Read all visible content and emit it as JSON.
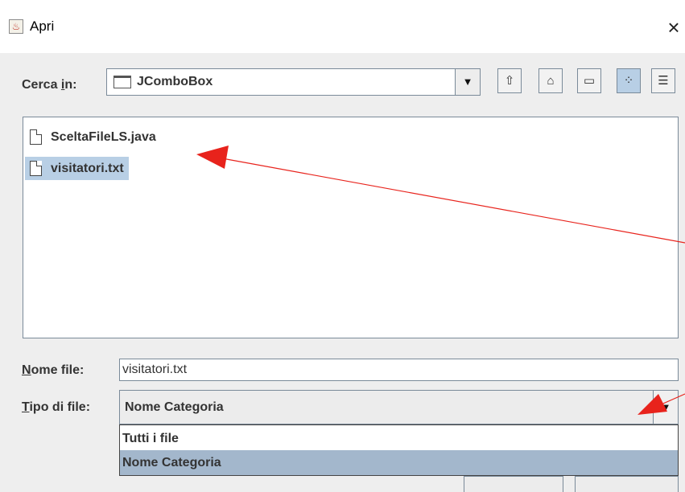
{
  "window": {
    "title": "Apri",
    "close_glyph": "×",
    "app_icon": "java-cup-icon"
  },
  "look_in": {
    "label_prefix": "Cerca ",
    "label_mnemonic": "i",
    "label_suffix": "n:",
    "value": "JComboBox",
    "folder_icon": "folder-icon",
    "arrow": "▼"
  },
  "toolbar": {
    "up_glyph": "⇧",
    "home_glyph": "⌂",
    "new_folder_glyph": "▭",
    "list_view_glyph": "⁘",
    "details_view_glyph": "☰"
  },
  "files": [
    {
      "name": "SceltaFileLS.java",
      "selected": false
    },
    {
      "name": "visitatori.txt",
      "selected": true
    }
  ],
  "filename": {
    "label_mnemonic": "N",
    "label_suffix": "ome file:",
    "value": "visitatori.txt"
  },
  "filetype": {
    "label_mnemonic": "T",
    "label_suffix": "ipo di file:",
    "value": "Nome Categoria",
    "arrow": "▼",
    "options": [
      {
        "label": "Tutti i file",
        "selected": false
      },
      {
        "label": "Nome Categoria",
        "selected": true
      }
    ]
  },
  "colors": {
    "selection": "#b8cfe5",
    "dropdown_selection": "#a3b7cc",
    "annotation_arrow": "#e8231c",
    "client_bg": "#eeeeee"
  }
}
